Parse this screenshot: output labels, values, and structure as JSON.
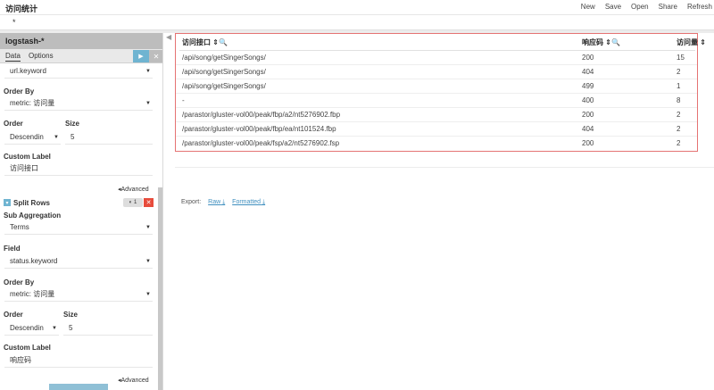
{
  "app": {
    "title": "访问统计"
  },
  "top_menu": [
    "New",
    "Save",
    "Open",
    "Share",
    "Refresh"
  ],
  "query": {
    "value": "*"
  },
  "sidebar": {
    "index_pattern": "logstash-*",
    "tabs": {
      "data": "Data",
      "options": "Options"
    },
    "agg1": {
      "field_value": "url.keyword",
      "order_by_label": "Order By",
      "order_by_value": "metric: 访问量",
      "order_label": "Order",
      "order_value": "Descendin",
      "size_label": "Size",
      "size_value": "5",
      "custom_label_label": "Custom Label",
      "custom_label_value": "访问接口",
      "advanced": "Advanced"
    },
    "split_rows": {
      "title": "Split Rows",
      "toggle": "1"
    },
    "agg2": {
      "sub_agg_label": "Sub Aggregation",
      "sub_agg_value": "Terms",
      "field_label": "Field",
      "field_value": "status.keyword",
      "order_by_label": "Order By",
      "order_by_value": "metric: 访问量",
      "order_label": "Order",
      "order_value": "Descendin",
      "size_label": "Size",
      "size_value": "5",
      "custom_label_label": "Custom Label",
      "custom_label_value": "响应码",
      "advanced": "Advanced"
    }
  },
  "table": {
    "headers": [
      "访问接口",
      "响应码",
      "访问量"
    ],
    "rows": [
      [
        "/api/song/getSingerSongs/",
        "200",
        "15"
      ],
      [
        "/api/song/getSingerSongs/",
        "404",
        "2"
      ],
      [
        "/api/song/getSingerSongs/",
        "499",
        "1"
      ],
      [
        "-",
        "400",
        "8"
      ],
      [
        "/parastor/gluster-vol00/peak/fbp/a2/nt5276902.fbp",
        "200",
        "2"
      ],
      [
        "/parastor/gluster-vol00/peak/fbp/ea/nt101524.fbp",
        "404",
        "2"
      ],
      [
        "/parastor/gluster-vol00/peak/fsp/a2/nt5276902.fsp",
        "200",
        "2"
      ]
    ]
  },
  "export": {
    "label": "Export:",
    "raw": "Raw",
    "formatted": "Formatted"
  },
  "colors": {
    "accent": "#6fb4d1",
    "danger": "#e74c3c",
    "table_border": "#e57373",
    "link": "#3f8fbf"
  }
}
